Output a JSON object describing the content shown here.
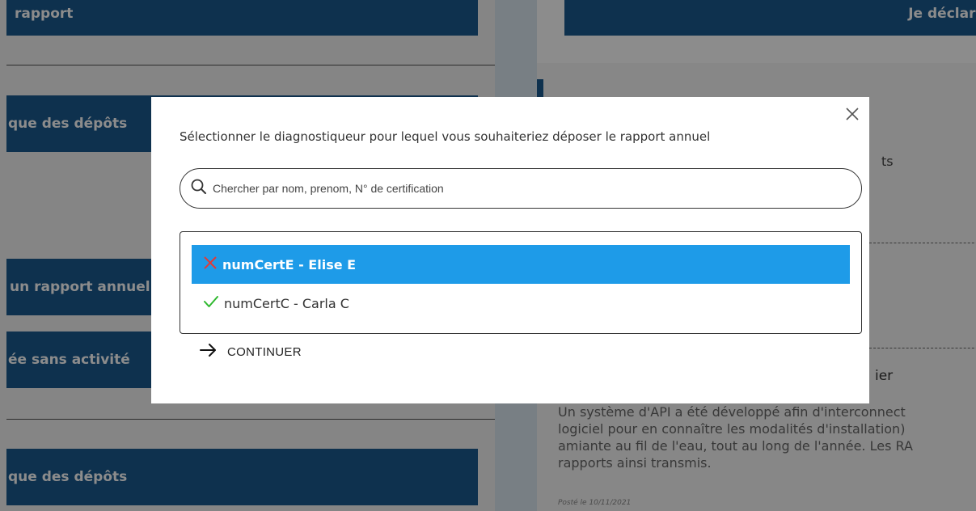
{
  "background": {
    "btn_rapport": "rapport",
    "btn_declarer": "Je déclare",
    "btn_historique1": "que des dépôts",
    "btn_rapport_annuel": "un rapport annuel",
    "btn_annee_sans": "ée sans activité",
    "btn_historique2": "que des dépôts",
    "right_frag_ts": "ts",
    "right_frag_ier": "ier",
    "article_lines": [
      "Un système d'API a été développé afin d'interconnect",
      "logiciel pour en connaître les modalités d'installation)",
      "amiante au fil de l'eau, tout au long de l'année. Les RA",
      "rapports ainsi transmis."
    ],
    "posted": "Posté le 10/11/2021"
  },
  "modal": {
    "title": "Sélectionner le diagnostiqueur pour lequel vous souhaiteriez déposer le rapport annuel",
    "search_placeholder": "Chercher par nom, prenom, N° de certification",
    "items": [
      {
        "label": "numCertE - Elise E",
        "status": "invalid",
        "status_icon": "cross-icon",
        "selected": true
      },
      {
        "label": "numCertC - Carla C",
        "status": "valid",
        "status_icon": "check-icon",
        "selected": false
      }
    ],
    "continue_label": "CONTINUER"
  },
  "colors": {
    "primary": "#1b5a8e",
    "selected": "#1e9be8",
    "cross": "#e53935",
    "check": "#2eb82e"
  }
}
